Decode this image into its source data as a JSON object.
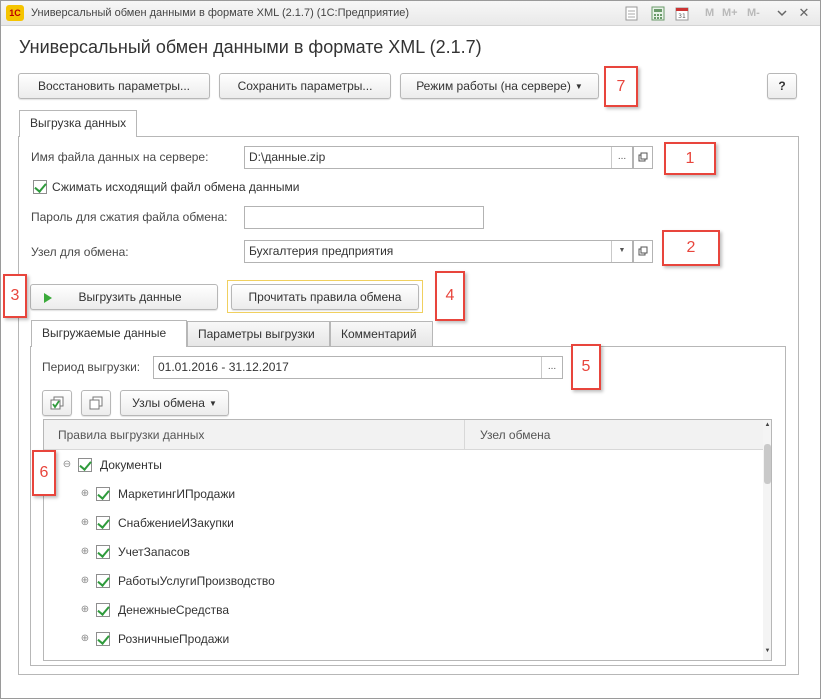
{
  "window": {
    "title": "Универсальный обмен данными в формате XML (2.1.7)  (1С:Предприятие)",
    "logo": "1С",
    "m_buttons": [
      "M",
      "M+",
      "M-"
    ]
  },
  "form": {
    "title": "Универсальный обмен данными в формате XML (2.1.7)"
  },
  "toolbar": {
    "restore_label": "Восстановить параметры...",
    "save_label": "Сохранить параметры...",
    "mode_label": "Режим работы (на сервере)",
    "help_label": "?"
  },
  "outer_tab": {
    "label": "Выгрузка данных"
  },
  "fields": {
    "file_label": "Имя файла данных на сервере:",
    "file_value": "D:\\данные.zip",
    "compress_label": "Сжимать исходящий файл обмена данными",
    "compress_checked": true,
    "password_label": "Пароль для сжатия файла обмена:",
    "password_value": "",
    "node_label": "Узел для обмена:",
    "node_value": "Бухгалтерия предприятия"
  },
  "actions": {
    "export_label": "Выгрузить данные",
    "read_rules_label": "Прочитать правила обмена"
  },
  "inner_tabs": [
    {
      "label": "Выгружаемые данные"
    },
    {
      "label": "Параметры выгрузки"
    },
    {
      "label": "Комментарий"
    }
  ],
  "period": {
    "label": "Период выгрузки:",
    "value": "01.01.2016 - 31.12.2017"
  },
  "grid_toolbar": {
    "nodes_label": "Узлы обмена"
  },
  "table": {
    "columns": [
      "Правила выгрузки данных",
      "Узел обмена"
    ],
    "rows": [
      {
        "label": "Документы",
        "level": 0,
        "expander": "⊖",
        "checked": true
      },
      {
        "label": "МаркетингИПродажи",
        "level": 1,
        "expander": "⊕",
        "checked": true
      },
      {
        "label": "СнабжениеИЗакупки",
        "level": 1,
        "expander": "⊕",
        "checked": true
      },
      {
        "label": "УчетЗапасов",
        "level": 1,
        "expander": "⊕",
        "checked": true
      },
      {
        "label": "РаботыУслугиПроизводство",
        "level": 1,
        "expander": "⊕",
        "checked": true
      },
      {
        "label": "ДенежныеСредства",
        "level": 1,
        "expander": "⊕",
        "checked": true
      },
      {
        "label": "РозничныеПродажи",
        "level": 1,
        "expander": "⊕",
        "checked": true
      }
    ]
  },
  "annotations": [
    "1",
    "2",
    "3",
    "4",
    "5",
    "6",
    "7"
  ],
  "colors": {
    "annotation": "#e8453c",
    "check": "#2f9b3c",
    "highlight_border": "#f0d060"
  }
}
